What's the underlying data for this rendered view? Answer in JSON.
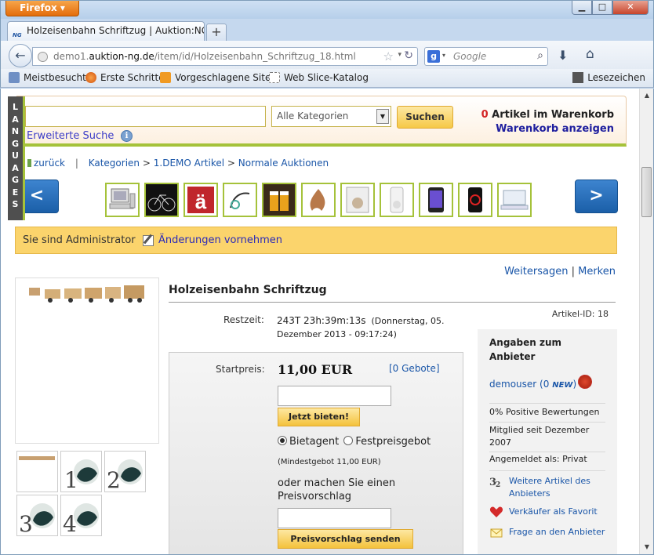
{
  "browser": {
    "menu_button": "Firefox",
    "tab_title": "Holzeisenbahn Schriftzug | Auktion:NG -...",
    "tab_favicon_text": "NG",
    "url_prefix": "demo1.",
    "url_domain": "auktion-ng.de",
    "url_path": "/item/id/Holzeisenbahn_Schriftzug_18.html",
    "search_engine_placeholder": "Google",
    "bookmarks": [
      "Meistbesucht",
      "Erste Schritte",
      "Vorgeschlagene Sites",
      "Web Slice-Katalog"
    ],
    "bookmarks_right": "Lesezeichen"
  },
  "page": {
    "languages_tab": "LANGUAGES",
    "search": {
      "category_value": "Alle Kategorien",
      "button": "Suchen",
      "advanced": "Erweiterte Suche",
      "info_glyph": "i"
    },
    "cart": {
      "count": "0",
      "count_label": "Artikel im Warenkorb",
      "link": "Warenkorb anzeigen"
    },
    "breadcrumb": {
      "back": "zurück",
      "categories": "Kategorien",
      "arrow": ">",
      "level1": "1.DEMO Artikel",
      "level2": "Normale Auktionen",
      "separator": "|"
    },
    "carousel": {
      "prev": "<",
      "next": ">",
      "thumbnails": [
        "computer",
        "bicycle",
        "letter-a-umlaut",
        "hand-drawing",
        "beer",
        "fire",
        "cat-book",
        "ipod-white",
        "phone",
        "music-player",
        "laptop"
      ]
    },
    "admin": {
      "text": "Sie sind Administrator",
      "link": "Änderungen vornehmen"
    },
    "share": {
      "tell": "Weitersagen",
      "sep": "|",
      "remember": "Merken"
    },
    "item": {
      "title": "Holzeisenbahn Schriftzug",
      "article_id": "Artikel-ID: 18",
      "remaining_label": "Restzeit:",
      "remaining_value": "243T 23h:39m:13s",
      "remaining_date": "(Donnerstag, 05. Dezember 2013 - 09:17:24)",
      "start_label": "Startpreis:",
      "price": "11,00 EUR",
      "bids": "[0 Gebote]",
      "bid_button": "Jetzt bieten!",
      "radio_agent": "Bietagent",
      "radio_fixed": "Festpreisgebot",
      "radio_selected": "agent",
      "min_bid": "(Mindestgebot 11,00 EUR)",
      "offer_text": "oder machen Sie einen Preisvorschlag",
      "offer_button": "Preisvorschlag senden"
    },
    "gallery": [
      "main-train",
      "thumb-1",
      "thumb-2",
      "thumb-3",
      "thumb-4"
    ],
    "gallery_digits": [
      "1",
      "2",
      "3",
      "4"
    ],
    "seller": {
      "heading": "Angaben zum Anbieter",
      "name": "demouser",
      "score": "(0",
      "new_badge": "NEW",
      "close_paren": ")",
      "positive": "0% Positive Bewertungen",
      "member_since": "Mitglied seit Dezember 2007",
      "registered_as": "Angemeldet als: Privat",
      "more_items": "Weitere Artikel des Anbieters",
      "favorite": "Verkäufer als Favorit",
      "ask": "Frage an den Anbieter"
    }
  },
  "colors": {
    "accent_green": "#a5c23a",
    "link_blue": "#1a56a8",
    "button_gold": "#f6c947",
    "admin_bar": "#fbd46c",
    "nav_blue": "#1b5fa8"
  }
}
